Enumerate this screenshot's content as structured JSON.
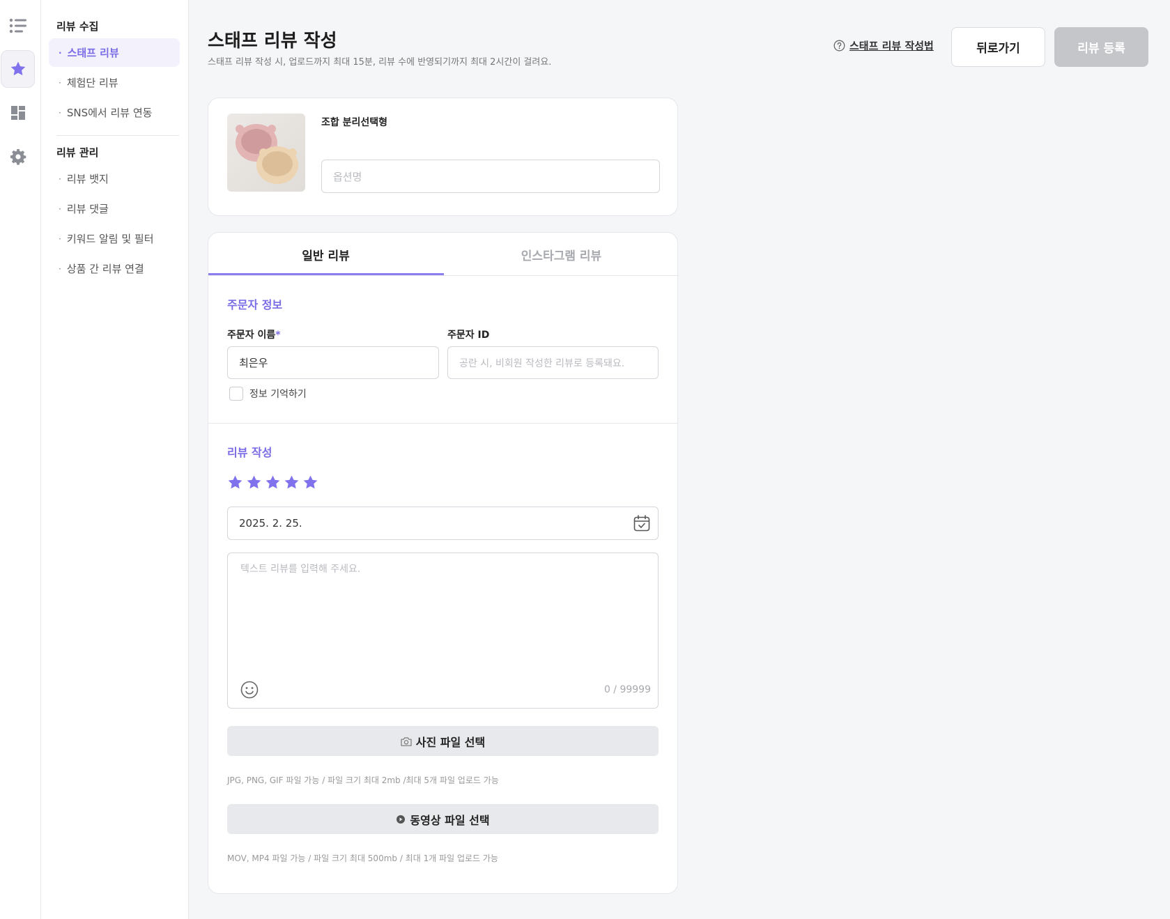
{
  "sidebar": {
    "groups": [
      {
        "title": "리뷰 수집",
        "items": [
          "스태프 리뷰",
          "체험단 리뷰",
          "SNS에서 리뷰 연동"
        ]
      },
      {
        "title": "리뷰 관리",
        "items": [
          "리뷰 뱃지",
          "리뷰 댓글",
          "키워드 알림 및 필터",
          "상품 간 리뷰 연결"
        ]
      }
    ],
    "bullet": "·",
    "active_item": "스태프 리뷰"
  },
  "icons": {
    "rail": [
      "list-icon",
      "star-icon",
      "dashboard-icon",
      "gear-icon"
    ],
    "accent": "#8b7fef"
  },
  "header": {
    "title": "스태프 리뷰 작성",
    "description": "스태프 리뷰 작성 시, 업로드까지 최대 15분, 리뷰 수에 반영되기까지 최대 2시간이 걸려요.",
    "guide_link": "스태프 리뷰 작성법",
    "back_button": "뒤로가기",
    "submit_button": "리뷰 등록"
  },
  "product": {
    "option_type": "조합 분리선택형",
    "option_placeholder": "옵션명"
  },
  "tabs": [
    "일반 리뷰",
    "인스타그램 리뷰"
  ],
  "orderer": {
    "section_title": "주문자 정보",
    "name_label": "주문자 이름",
    "required_mark": "*",
    "name_value": "최은우",
    "id_label": "주문자 ID",
    "id_placeholder": "공란 시, 비회원 작성한 리뷰로 등록돼요.",
    "remember_label": "정보 기억하기"
  },
  "review": {
    "section_title": "리뷰 작성",
    "rating": 5,
    "date_value": "2025. 2. 25.",
    "text_placeholder": "텍스트 리뷰를 입력해 주세요.",
    "char_count": "0 / 99999",
    "photo_button": "사진 파일 선택",
    "photo_hint": "JPG, PNG, GIF 파일 가능 / 파일 크기 최대 2mb /최대 5개 파일 업로드 가능",
    "video_button": "동영상 파일 선택",
    "video_hint": "MOV, MP4 파일 가능 / 파일 크기 최대 500mb / 최대 1개 파일 업로드 가능"
  }
}
